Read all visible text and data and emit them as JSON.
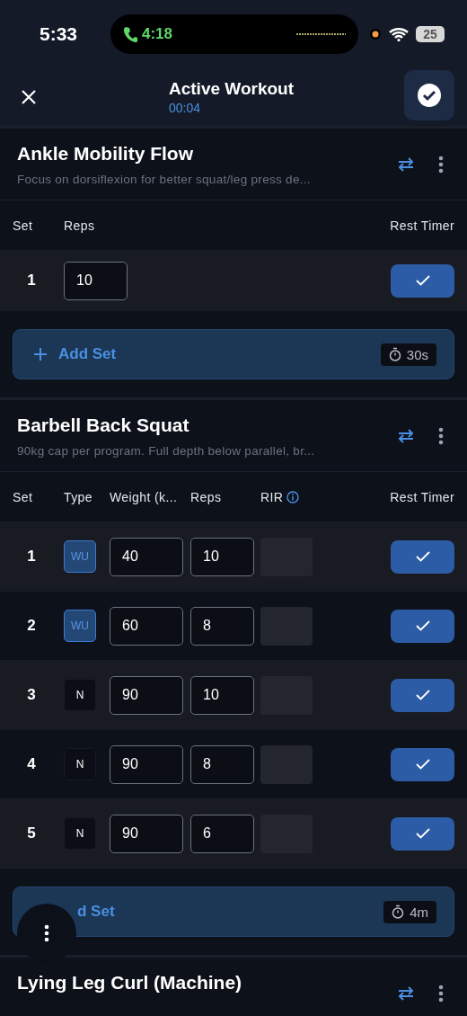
{
  "status_bar": {
    "time": "5:33",
    "call_time": "4:18",
    "battery": "25"
  },
  "header": {
    "title": "Active Workout",
    "elapsed": "00:04"
  },
  "exercises": [
    {
      "name": "Ankle Mobility Flow",
      "note": "Focus on dorsiflexion for better squat/leg press de...",
      "columns": [
        {
          "label": "Set",
          "kind": "set"
        },
        {
          "label": "Reps",
          "kind": "reps"
        },
        {
          "label": "Rest Timer",
          "kind": "done"
        }
      ],
      "rows": [
        {
          "set": "1",
          "reps": "10",
          "done": true
        }
      ],
      "add_set": {
        "plus_visible": true,
        "label_text": "Add Set",
        "timer": "30s"
      }
    },
    {
      "name": "Barbell Back Squat",
      "note": "90kg cap per program. Full depth below parallel, br...",
      "columns": [
        {
          "label": "Set",
          "kind": "set"
        },
        {
          "label": "Type",
          "kind": "type"
        },
        {
          "label": "Weight (k...",
          "kind": "weight"
        },
        {
          "label": "Reps",
          "kind": "reps"
        },
        {
          "label": "RIR",
          "kind": "rir",
          "info": true
        },
        {
          "label": "Rest Timer",
          "kind": "done"
        }
      ],
      "rows": [
        {
          "set": "1",
          "type": "WU",
          "kind": "warmup",
          "weight": "40",
          "reps": "10",
          "done": true
        },
        {
          "set": "2",
          "type": "WU",
          "kind": "warmup",
          "weight": "60",
          "reps": "8",
          "done": true
        },
        {
          "set": "3",
          "type": "N",
          "kind": "normal",
          "weight": "90",
          "reps": "10",
          "done": true
        },
        {
          "set": "4",
          "type": "N",
          "kind": "normal",
          "weight": "90",
          "reps": "8",
          "done": true
        },
        {
          "set": "5",
          "type": "N",
          "kind": "normal",
          "weight": "90",
          "reps": "6",
          "done": true
        }
      ],
      "add_set": {
        "plus_visible": false,
        "label_text": "d Set",
        "timer": "4m"
      }
    },
    {
      "name": "Lying Leg Curl (Machine)"
    }
  ]
}
